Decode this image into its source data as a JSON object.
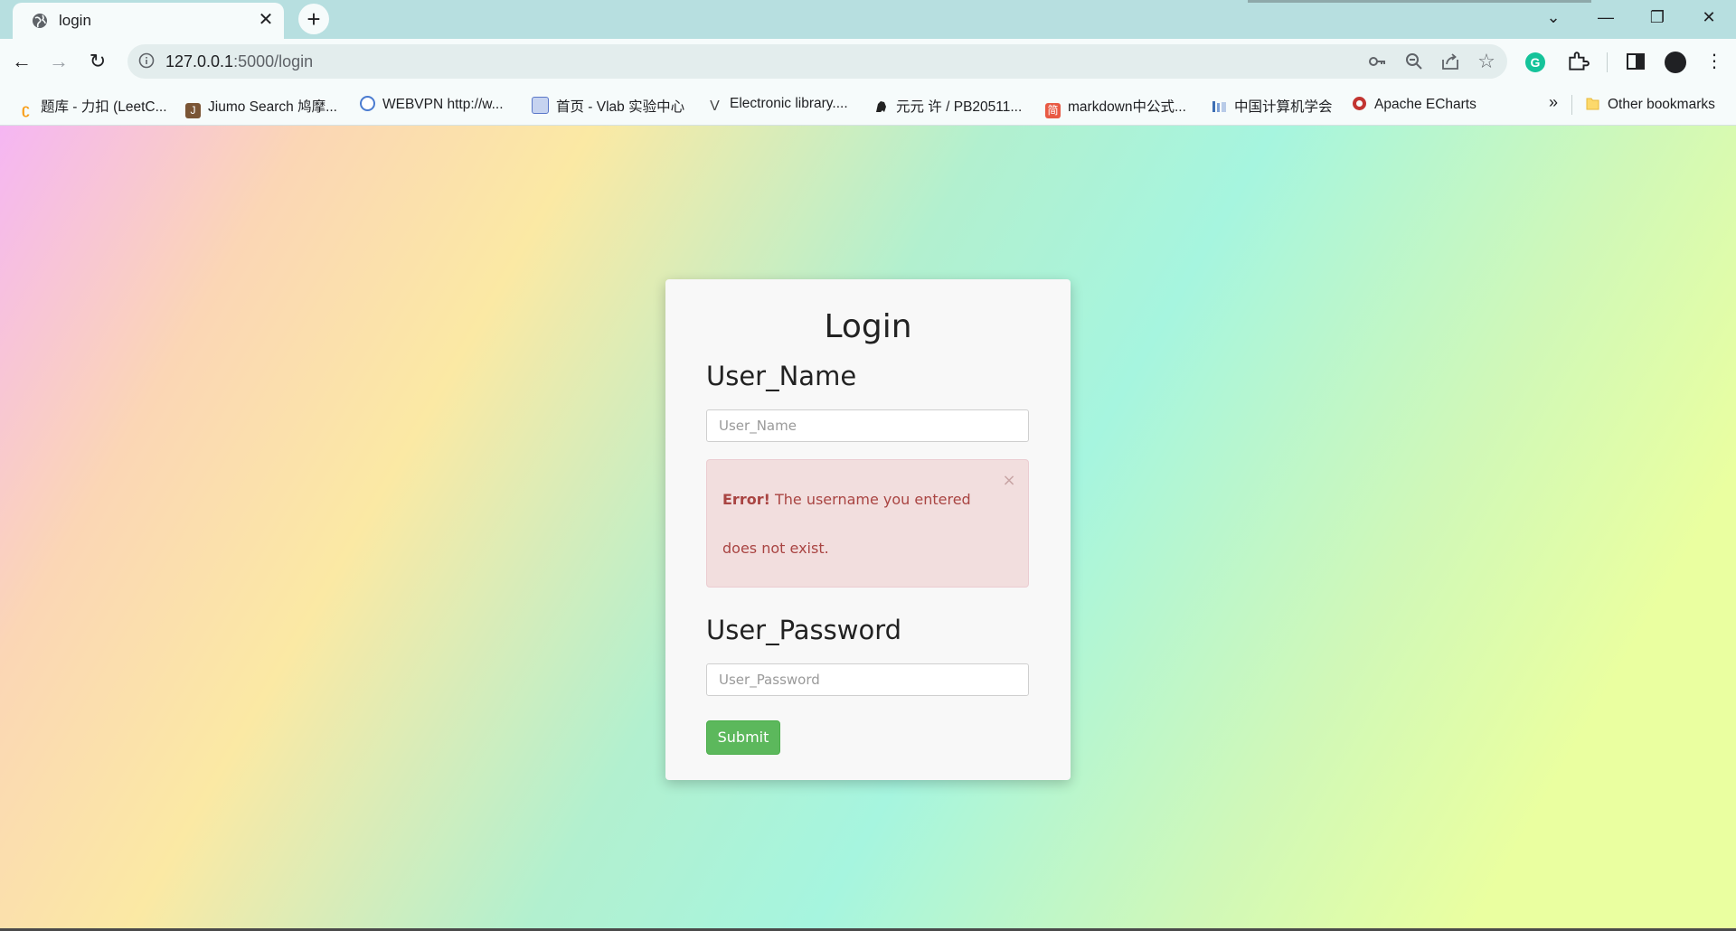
{
  "browser": {
    "tab": {
      "title": "login",
      "close_glyph": "✕",
      "favicon": "globe-icon"
    },
    "new_tab_glyph": "+",
    "window_controls": {
      "tab_search": "⌄",
      "minimize": "—",
      "restore": "❐",
      "close": "✕"
    },
    "nav": {
      "back": "←",
      "forward": "→",
      "reload": "↻"
    },
    "address": {
      "host": "127.0.0.1",
      "path": ":5000/login"
    },
    "omnibox_icons": {
      "key": "key-icon",
      "zoom": "zoom-out-icon",
      "share": "share-icon",
      "star": "☆"
    },
    "toolbar_icons": {
      "grammarly": "G",
      "extensions": "puzzle-icon",
      "sidepanel": "sidepanel-icon",
      "menu": "⋮"
    },
    "bookmarks": [
      {
        "label": "题库 - 力扣 (LeetC...",
        "icon": "leetcode-icon",
        "color": "#f89f1b"
      },
      {
        "label": "Jiumo Search 鸠摩...",
        "icon": "J",
        "color": "#7a5535"
      },
      {
        "label": "WEBVPN http://w...",
        "icon": "webvpn-icon",
        "color": "#4a7bd0"
      },
      {
        "label": "首页 - Vlab 实验中心",
        "icon": "vlab-icon",
        "color": "#5b78c9"
      },
      {
        "label": "Electronic library....",
        "icon": "V",
        "color": "#444444"
      },
      {
        "label": "元元 许 / PB20511...",
        "icon": "octocat-icon",
        "color": "#222222"
      },
      {
        "label": "markdown中公式...",
        "icon": "简",
        "color": "#e85a44"
      },
      {
        "label": "中国计算机学会",
        "icon": "ccf-icon",
        "color": "#3d6eb4"
      },
      {
        "label": "Apache ECharts",
        "icon": "echarts-icon",
        "color": "#c23531"
      }
    ],
    "bookmarks_overflow": "»",
    "other_bookmarks": "Other bookmarks"
  },
  "login": {
    "title": "Login",
    "username_label": "User_Name",
    "username_placeholder": "User_Name",
    "alert": {
      "strong": "Error!",
      "text_line1": " The username you entered",
      "text_line2": "does not exist.",
      "close_glyph": "×"
    },
    "password_label": "User_Password",
    "password_placeholder": "User_Password",
    "submit_label": "Submit"
  },
  "colors": {
    "alert_bg": "#f2dede",
    "alert_text": "#a94442",
    "submit_bg": "#5cb85c"
  }
}
